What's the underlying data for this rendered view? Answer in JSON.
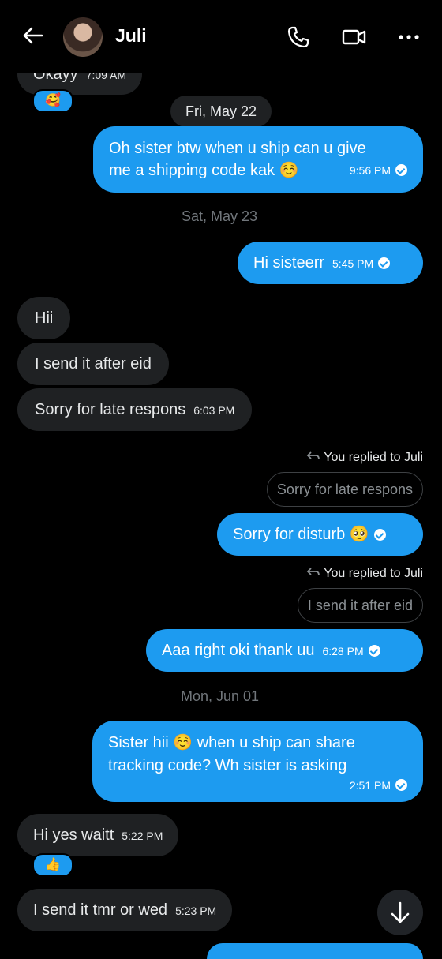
{
  "header": {
    "contact_name": "Juli",
    "icons": [
      "back-arrow-icon",
      "avatar",
      "phone-icon",
      "video-icon",
      "more-icon"
    ]
  },
  "messages": {
    "m0": {
      "text": "Okayy",
      "time": "7:09 AM",
      "reaction": "🥰"
    },
    "date1": "Fri, May 22",
    "m1": {
      "line1": "Oh sister btw when u ship can u give",
      "line2": "me a shipping code kak ☺️",
      "time": "9:56 PM"
    },
    "date2": "Sat, May 23",
    "m2": {
      "text": "Hi sisteerr",
      "time": "5:45 PM"
    },
    "m3": {
      "text": "Hii"
    },
    "m4": {
      "text": "I send it after eid"
    },
    "m5": {
      "text": "Sorry for late respons",
      "time": "6:03 PM"
    },
    "reply1": {
      "label": "You replied to Juli",
      "quote": "Sorry for late respons"
    },
    "m6": {
      "text": "Sorry for disturb 🥺"
    },
    "reply2": {
      "label": "You replied to Juli",
      "quote": "I send it after eid"
    },
    "m7": {
      "text": "Aaa right oki thank uu",
      "time": "6:28 PM"
    },
    "date3": "Mon, Jun 01",
    "m8": {
      "line1": "Sister hii ☺️ when u ship can share",
      "line2": "tracking code? Wh sister is asking",
      "time": "2:51 PM"
    },
    "m9": {
      "text": "Hi yes waitt",
      "time": "5:22 PM",
      "reaction": "👍"
    },
    "m10": {
      "text": "I send it tmr or wed",
      "time": "5:23 PM"
    }
  },
  "colors": {
    "background": "#000000",
    "incoming": "#1f2123",
    "outgoing": "#1d9bf0"
  }
}
